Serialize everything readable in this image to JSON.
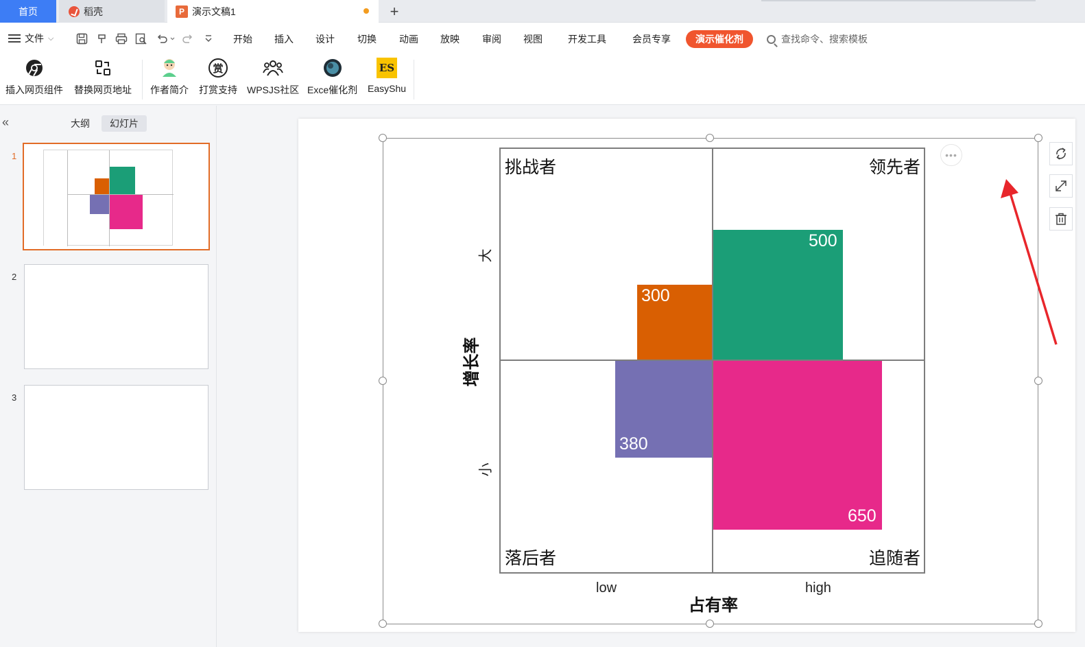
{
  "tabs": {
    "home": "首页",
    "daoke": "稻壳",
    "doc": "演示文稿1",
    "plus": "+"
  },
  "menu": {
    "file": "文件",
    "items": [
      "开始",
      "插入",
      "设计",
      "切换",
      "动画",
      "放映",
      "审阅",
      "视图",
      "开发工具",
      "会员专享"
    ],
    "active": "演示催化剂",
    "search": "查找命令、搜索模板"
  },
  "ribbon": {
    "items": [
      "插入网页组件",
      "替换网页地址",
      "作者简介",
      "打赏支持",
      "WPSJS社区",
      "Exce催化剂",
      "EasyShu"
    ],
    "icons": [
      "chrome-icon",
      "replace-url-icon",
      "avatar-icon",
      "reward-icon",
      "community-icon",
      "excel-catalyst-icon",
      "easyshu-icon"
    ],
    "reward_glyph": "赏",
    "easyshu_glyph": "ES"
  },
  "left_pane": {
    "collapse": "«",
    "tab_outline": "大纲",
    "tab_slides": "幻灯片",
    "slide_numbers": [
      "1",
      "2",
      "3"
    ]
  },
  "chart_data": {
    "type": "bar",
    "quadrants": {
      "top_left": "挑战者",
      "top_right": "领先者",
      "bottom_left": "落后者",
      "bottom_right": "追随者"
    },
    "series": [
      {
        "quadrant": "top_left",
        "value": 300,
        "color": "#d95f02"
      },
      {
        "quadrant": "top_right",
        "value": 500,
        "color": "#1b9e77"
      },
      {
        "quadrant": "bottom_left",
        "value": 380,
        "color": "#7570b3"
      },
      {
        "quadrant": "bottom_right",
        "value": 650,
        "color": "#e7298a"
      }
    ],
    "xticks": [
      "low",
      "high"
    ],
    "yticks": [
      "大",
      "小"
    ],
    "xlabel": "占有率",
    "ylabel": "增长率"
  },
  "more_button": "•••",
  "colors": {
    "accent": "#f0552e",
    "home_tab": "#3d7df5",
    "arrow": "#e8262b"
  }
}
